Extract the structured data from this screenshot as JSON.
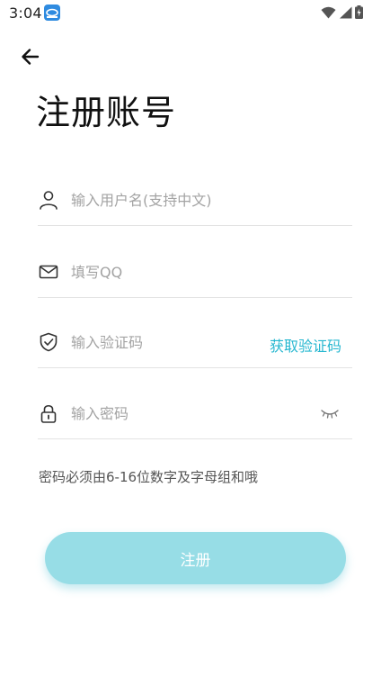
{
  "status_bar": {
    "time": "3:04",
    "icons": [
      "app-notification-icon",
      "wifi-icon",
      "signal-icon",
      "battery-icon"
    ]
  },
  "header": {
    "back_icon": "arrow-left-icon",
    "title": "注册账号"
  },
  "form": {
    "username": {
      "icon": "user-icon",
      "placeholder": "输入用户名(支持中文)",
      "value": ""
    },
    "qq": {
      "icon": "mail-icon",
      "placeholder": "填写QQ",
      "value": ""
    },
    "code": {
      "icon": "shield-check-icon",
      "placeholder": "输入验证码",
      "value": "",
      "get_code_label": "获取验证码"
    },
    "password": {
      "icon": "lock-icon",
      "placeholder": "输入密码",
      "value": "",
      "visibility_icon": "eye-closed-icon"
    },
    "hint": "密码必须由6-16位数字及字母组和哦",
    "submit_label": "注册"
  },
  "colors": {
    "accent": "#26b7d0",
    "button": "#97dde6",
    "divider": "#e3e3e3",
    "placeholder": "#a3a3a3"
  }
}
